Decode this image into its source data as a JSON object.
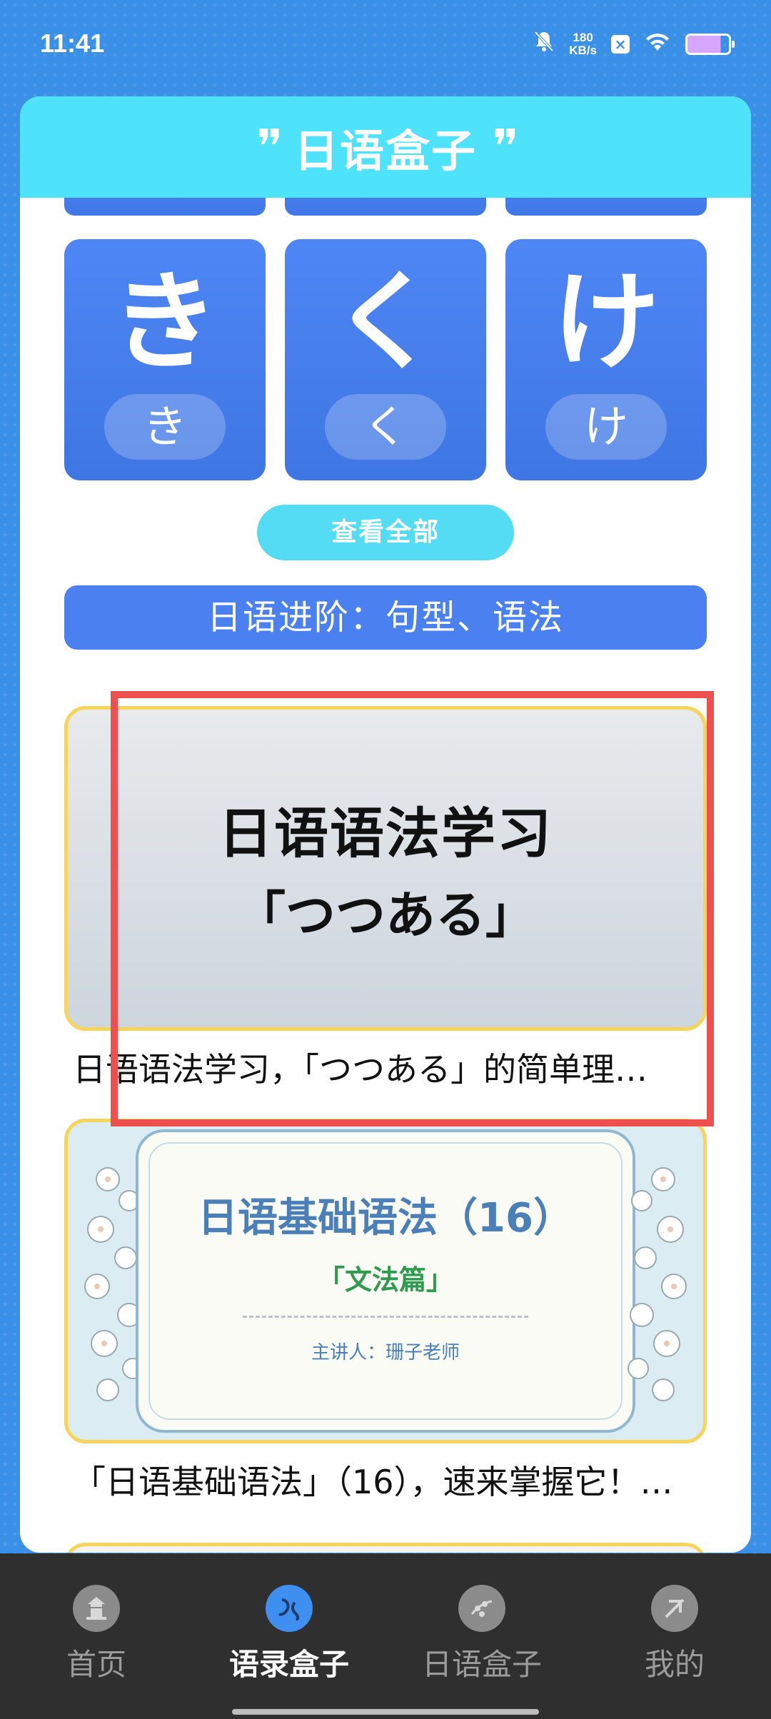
{
  "status_bar": {
    "time": "11:41",
    "net_speed_value": "180",
    "net_speed_unit": "KB/s",
    "icons": [
      "mute-icon",
      "network-speed",
      "app-badge-icon",
      "wifi-icon",
      "battery-icon"
    ]
  },
  "header": {
    "title": "日语盒子"
  },
  "kana_cards": [
    {
      "big": "き",
      "small": "き"
    },
    {
      "big": "く",
      "small": "く"
    },
    {
      "big": "け",
      "small": "け"
    }
  ],
  "view_all_label": "查看全部",
  "section_banner": "日语进阶：句型、语法",
  "articles": [
    {
      "thumb_line1": "日语语法学习",
      "thumb_line2": "「つつある」",
      "title": "日语语法学习，「つつある」的简单理…"
    },
    {
      "thumb_title": "日语基础语法（16）",
      "thumb_sub": "「文法篇」",
      "thumb_presenter": "主讲人：珊子老师",
      "title": "「日语基础语法」（16），速来掌握它！…"
    }
  ],
  "bottom_nav": [
    {
      "label": "首页",
      "icon": "home-icon",
      "active": false
    },
    {
      "label": "语录盒子",
      "icon": "quotes-box-icon",
      "active": true
    },
    {
      "label": "日语盒子",
      "icon": "japanese-box-icon",
      "active": false
    },
    {
      "label": "我的",
      "icon": "profile-icon",
      "active": false
    }
  ],
  "colors": {
    "accent_blue": "#4a80f0",
    "header_cyan": "#4fe3fb",
    "highlight_red": "#ee5050",
    "card_border_yellow": "#f7d45a"
  }
}
